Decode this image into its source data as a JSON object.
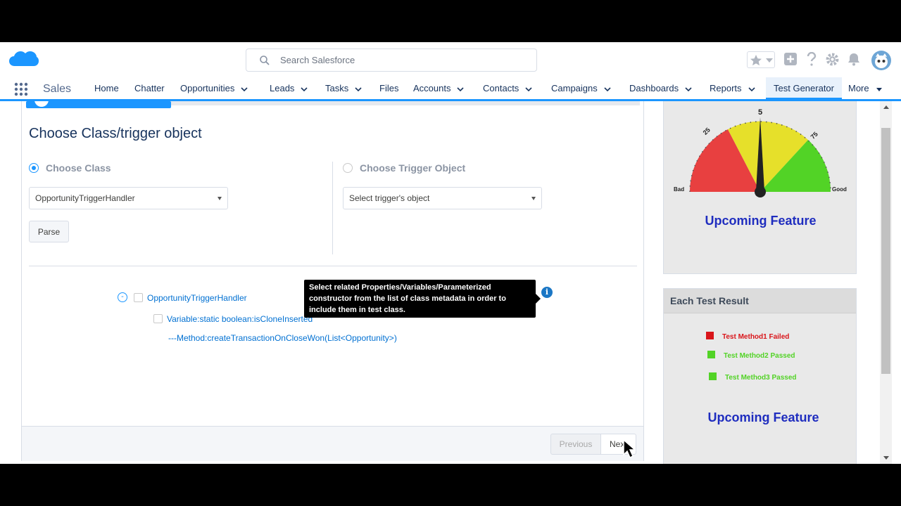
{
  "header": {
    "search_placeholder": "Search Salesforce",
    "brand_color": "#1b96ff"
  },
  "nav": {
    "app_name": "Sales",
    "items": [
      {
        "label": "Home"
      },
      {
        "label": "Chatter"
      },
      {
        "label": "Opportunities"
      },
      {
        "label": "Leads"
      },
      {
        "label": "Tasks"
      },
      {
        "label": "Files"
      },
      {
        "label": "Accounts"
      },
      {
        "label": "Contacts"
      },
      {
        "label": "Campaigns"
      },
      {
        "label": "Dashboards"
      },
      {
        "label": "Reports"
      },
      {
        "label": "Test Generator",
        "active": true
      },
      {
        "label": "More"
      }
    ]
  },
  "main": {
    "title": "Choose Class/trigger object",
    "choose_class_label": "Choose Class",
    "choose_trigger_label": "Choose Trigger Object",
    "class_select_value": "OpportunityTriggerHandler",
    "trigger_select_value": "Select trigger's object",
    "parse_label": "Parse",
    "tree": {
      "root": "OpportunityTriggerHandler",
      "toggle": "-",
      "variable": "Variable:static boolean:isCloneInserted",
      "method": "---Method:createTransactionOnCloseWon(List<Opportunity>)"
    },
    "tooltip": "Select related Properties/Variables/Parameterized constructor from the list of class metadata in order to include them in test class.",
    "info_icon_glyph": "i",
    "previous_label": "Previous",
    "next_label": "Next"
  },
  "gauge_panel": {
    "labels": {
      "bad": "Bad",
      "good": "Good",
      "top": "5",
      "left": "25",
      "right": "75"
    },
    "caption": "Upcoming Feature"
  },
  "result_panel": {
    "header": "Each Test Result",
    "rows": [
      {
        "label": "Test Method1 Failed",
        "color": "#d9151a"
      },
      {
        "label": "Test Method2 Passed",
        "color": "#52d326"
      },
      {
        "label": "Test Method3 Passed",
        "color": "#52d326"
      }
    ],
    "caption": "Upcoming Feature"
  }
}
